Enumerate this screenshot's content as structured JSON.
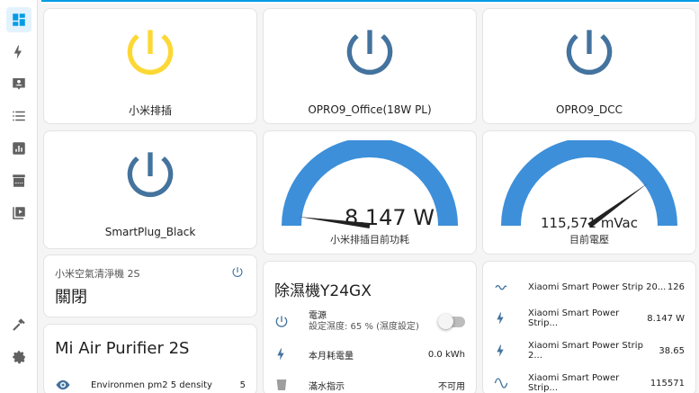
{
  "colors": {
    "accent": "#039be5",
    "on": "#fdd835",
    "off": "#44739e",
    "gauge": "#3d8fd9"
  },
  "sidebar": {
    "items": [
      {
        "name": "overview",
        "icon": "dashboard-icon"
      },
      {
        "name": "energy",
        "icon": "lightning-icon"
      },
      {
        "name": "logbook",
        "icon": "account-box-icon"
      },
      {
        "name": "history",
        "icon": "list-icon"
      },
      {
        "name": "statistics",
        "icon": "chart-icon"
      },
      {
        "name": "hacs",
        "icon": "hacs-store-icon"
      },
      {
        "name": "media",
        "icon": "play-box-icon"
      }
    ],
    "bottom": [
      {
        "name": "developer-tools",
        "icon": "hammer-icon"
      },
      {
        "name": "settings",
        "icon": "gear-icon"
      }
    ]
  },
  "buttons": [
    {
      "label": "小米排插",
      "state": "on"
    },
    {
      "label": "OPRO9_Office(18W PL)",
      "state": "off"
    },
    {
      "label": "OPRO9_DCC",
      "state": "off"
    },
    {
      "label": "SmartPlug_Black",
      "state": "off"
    }
  ],
  "gauges": [
    {
      "value": "8.147 W",
      "name": "小米排插目前功耗",
      "fraction": 0.04
    },
    {
      "value": "115,571 mVac",
      "name": "目前電壓",
      "fraction": 0.8
    }
  ],
  "purifier_state": {
    "title": "小米空氣清淨機 2S",
    "state": "關閉"
  },
  "purifier_entities": {
    "title": "Mi Air Purifier 2S",
    "rows": [
      {
        "icon": "eye-icon",
        "label": "Environmen pm2 5 density",
        "value": "5"
      }
    ]
  },
  "dehumidifier": {
    "title": "除濕機Y24GX",
    "rows": [
      {
        "icon": "power-icon",
        "label": "電源",
        "sub": "設定濕度: 65 % (濕度設定)",
        "value": ""
      },
      {
        "icon": "lightning-icon",
        "label": "本月耗電量",
        "value": "0.0 kWh"
      },
      {
        "icon": "water-cup-icon",
        "label": "滿水指示",
        "value": "不可用"
      }
    ]
  },
  "power_strip": {
    "rows": [
      {
        "icon": "current-ac-icon",
        "label": "Xiaomi Smart Power Strip 20...",
        "value": "126"
      },
      {
        "icon": "lightning-icon",
        "label": "Xiaomi Smart Power Strip...",
        "value": "8.147 W"
      },
      {
        "icon": "lightning-icon",
        "label": "Xiaomi Smart Power Strip 2...",
        "value": "38.65"
      },
      {
        "icon": "sine-wave-icon",
        "label": "Xiaomi Smart Power Strip...",
        "value": "115571"
      }
    ]
  }
}
